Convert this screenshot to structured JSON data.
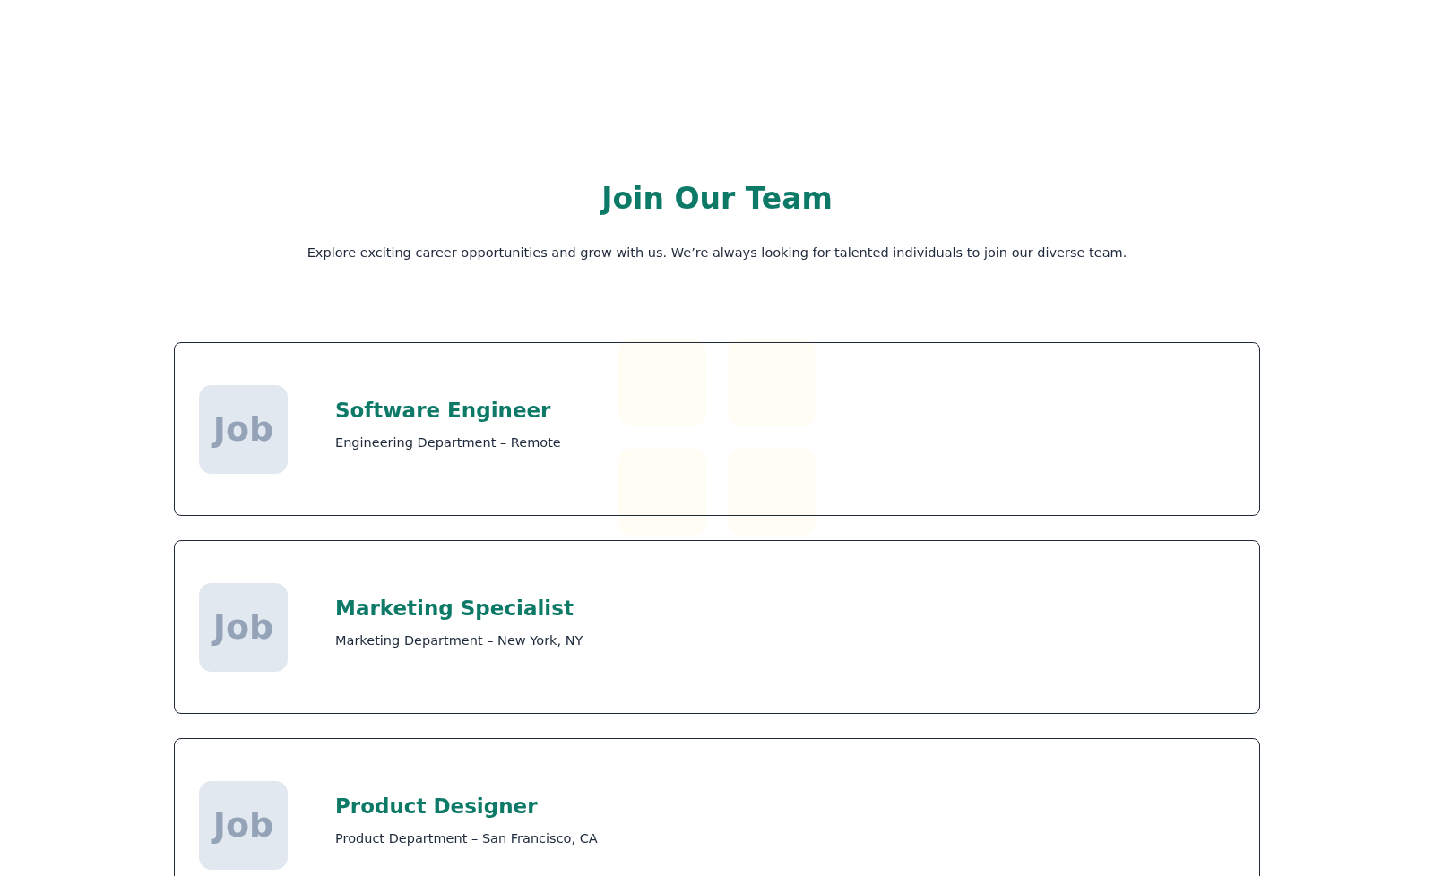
{
  "header": {
    "title": "Join Our Team",
    "subtitle": "Explore exciting career opportunities and grow with us. We’re always looking for talented individuals to join our diverse team."
  },
  "jobs": [
    {
      "badge": "Job",
      "title": "Software Engineer",
      "meta": "Engineering Department – Remote"
    },
    {
      "badge": "Job",
      "title": "Marketing Specialist",
      "meta": "Marketing Department – New York, NY"
    },
    {
      "badge": "Job",
      "title": "Product Designer",
      "meta": "Product Department – San Francisco, CA"
    }
  ]
}
